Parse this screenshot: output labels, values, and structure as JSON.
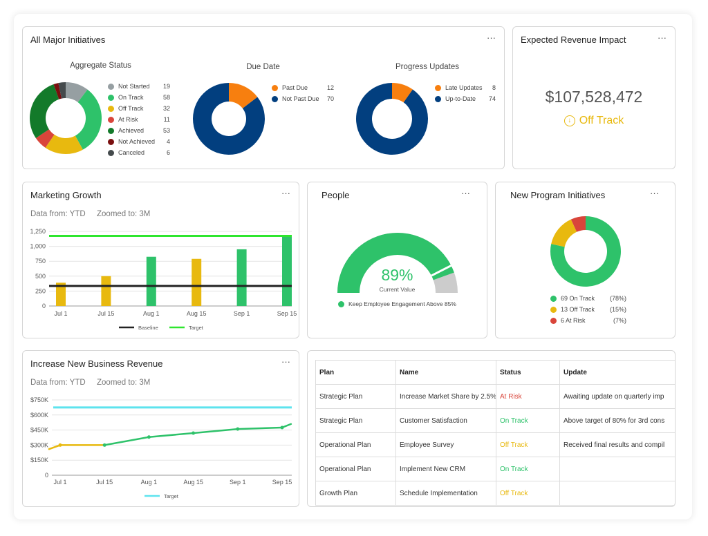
{
  "colors": {
    "green": "#2ec26a",
    "dark_green": "#137a2a",
    "yellow": "#e8b90f",
    "red": "#d9453a",
    "dark_red": "#7a0f0f",
    "gray": "#969fa2",
    "dark_gray": "#444a4c",
    "orange": "#f77f0f",
    "navy": "#023f7f",
    "bright_green": "#2ee62e",
    "cyan": "#5de3ee",
    "black": "#222222",
    "gauge_rest": "#cccccc"
  },
  "initiatives": {
    "title": "All Major Initiatives",
    "menu": "···",
    "aggregate": {
      "title": "Aggregate Status",
      "items": [
        {
          "label": "Not Started",
          "value": 19,
          "color": "#969fa2"
        },
        {
          "label": "On Track",
          "value": 58,
          "color": "#2ec26a"
        },
        {
          "label": "Off Track",
          "value": 32,
          "color": "#e8b90f"
        },
        {
          "label": "At Risk",
          "value": 11,
          "color": "#d9453a"
        },
        {
          "label": "Achieved",
          "value": 53,
          "color": "#137a2a"
        },
        {
          "label": "Not Achieved",
          "value": 4,
          "color": "#7a0f0f"
        },
        {
          "label": "Canceled",
          "value": 6,
          "color": "#444a4c"
        }
      ]
    },
    "due_date": {
      "title": "Due Date",
      "items": [
        {
          "label": "Past Due",
          "value": 12,
          "color": "#f77f0f"
        },
        {
          "label": "Not Past Due",
          "value": 70,
          "color": "#023f7f"
        }
      ]
    },
    "progress": {
      "title": "Progress Updates",
      "items": [
        {
          "label": "Late Updates",
          "value": 8,
          "color": "#f77f0f"
        },
        {
          "label": "Up-to-Date",
          "value": 74,
          "color": "#023f7f"
        }
      ]
    }
  },
  "revenue_impact": {
    "title": "Expected Revenue Impact",
    "menu": "···",
    "value": "$107,528,472",
    "status": "Off Track",
    "status_icon": "arrow-down-circle-icon"
  },
  "marketing": {
    "title": "Marketing Growth",
    "menu": "···",
    "data_from": "Data from: YTD",
    "zoomed_to": "Zoomed to: 3M"
  },
  "people": {
    "title": "People",
    "menu": "···",
    "value_label": "89%",
    "caption": "Current Value",
    "legend": "Keep Employee Engagement Above 85%",
    "value": 0.89,
    "target": 0.85
  },
  "new_program": {
    "title": "New Program Initiatives",
    "menu": "···",
    "items": [
      {
        "label": "69 On Track",
        "pct": "(78%)",
        "value": 69,
        "color": "#2ec26a"
      },
      {
        "label": "13 Off Track",
        "pct": "(15%)",
        "value": 13,
        "color": "#e8b90f"
      },
      {
        "label": "6 At Risk",
        "pct": "(7%)",
        "value": 6,
        "color": "#d9453a"
      }
    ]
  },
  "business_revenue": {
    "title": "Increase New Business Revenue",
    "menu": "···",
    "data_from": "Data from: YTD",
    "zoomed_to": "Zoomed to: 3M"
  },
  "plans_table": {
    "headers": [
      "Plan",
      "Name",
      "Status",
      "Update"
    ],
    "rows": [
      {
        "plan": "Strategic Plan",
        "name": "Increase Market Share by 2.5%",
        "status": "At Risk",
        "status_color": "#d9453a",
        "update": "Awaiting update on quarterly imp"
      },
      {
        "plan": "Strategic Plan",
        "name": "Customer Satisfaction",
        "status": "On Track",
        "status_color": "#2ec26a",
        "update": "Above target of 80% for 3rd cons"
      },
      {
        "plan": "Operational Plan",
        "name": "Employee Survey",
        "status": "Off Track",
        "status_color": "#e8b90f",
        "update": "Received final results and compil"
      },
      {
        "plan": "Operational Plan",
        "name": "Implement New CRM",
        "status": "On Track",
        "status_color": "#2ec26a",
        "update": ""
      },
      {
        "plan": "Growth Plan",
        "name": "Schedule Implementation",
        "status": "Off Track",
        "status_color": "#e8b90f",
        "update": ""
      }
    ]
  },
  "chart_data": [
    {
      "type": "pie",
      "title": "Aggregate Status",
      "categories": [
        "Not Started",
        "On Track",
        "Off Track",
        "At Risk",
        "Achieved",
        "Not Achieved",
        "Canceled"
      ],
      "values": [
        19,
        58,
        32,
        11,
        53,
        4,
        6
      ],
      "legend": "right"
    },
    {
      "type": "pie",
      "title": "Due Date",
      "categories": [
        "Past Due",
        "Not Past Due"
      ],
      "values": [
        12,
        70
      ],
      "legend": "right"
    },
    {
      "type": "pie",
      "title": "Progress Updates",
      "categories": [
        "Late Updates",
        "Up-to-Date"
      ],
      "values": [
        8,
        74
      ],
      "legend": "right"
    },
    {
      "type": "bar",
      "title": "Marketing Growth",
      "categories": [
        "Jul 1",
        "Jul 15",
        "Aug 1",
        "Aug 15",
        "Sep 1",
        "Sep 15"
      ],
      "values": [
        390,
        500,
        825,
        790,
        950,
        1170
      ],
      "bar_colors": [
        "#e8b90f",
        "#e8b90f",
        "#2ec26a",
        "#e8b90f",
        "#2ec26a",
        "#2ec26a"
      ],
      "reference_lines": [
        {
          "name": "Baseline",
          "value": 335,
          "color": "#222222"
        },
        {
          "name": "Target",
          "value": 1175,
          "color": "#2ee62e"
        }
      ],
      "yticks": [
        0,
        250,
        500,
        750,
        1000,
        1250
      ],
      "ytick_labels": [
        "0",
        "250",
        "500",
        "750",
        "1,000",
        "1,250"
      ],
      "ylim": [
        0,
        1250
      ],
      "grid": true,
      "legend": "bottom"
    },
    {
      "type": "line",
      "title": "Increase New Business Revenue",
      "x": [
        "",
        "Jul 1",
        "Jul 15",
        "Aug 1",
        "Aug 15",
        "Sep 1",
        "Sep 15",
        ""
      ],
      "x_pos": [
        -0.25,
        0,
        1,
        2,
        3,
        4,
        5,
        5.2
      ],
      "values": [
        260000,
        300000,
        300000,
        380000,
        420000,
        460000,
        475000,
        510000
      ],
      "segment_colors": [
        "#e8b90f",
        "#e8b90f",
        "#2ec26a",
        "#2ec26a",
        "#2ec26a",
        "#2ec26a",
        "#2ec26a"
      ],
      "categories": [
        "Jul 1",
        "Jul 15",
        "Aug 1",
        "Aug 15",
        "Sep 1",
        "Sep 15"
      ],
      "reference_lines": [
        {
          "name": "Target",
          "value": 675000,
          "color": "#5de3ee"
        }
      ],
      "yticks": [
        0,
        150000,
        300000,
        450000,
        600000,
        750000
      ],
      "ytick_labels": [
        "0",
        "$150K",
        "$300K",
        "$450K",
        "$600K",
        "$750K"
      ],
      "ylim": [
        0,
        750000
      ],
      "grid": true,
      "legend": "bottom"
    },
    {
      "type": "pie",
      "title": "New Program Initiatives",
      "categories": [
        "On Track",
        "Off Track",
        "At Risk"
      ],
      "values": [
        69,
        13,
        6
      ],
      "legend": "bottom"
    }
  ]
}
